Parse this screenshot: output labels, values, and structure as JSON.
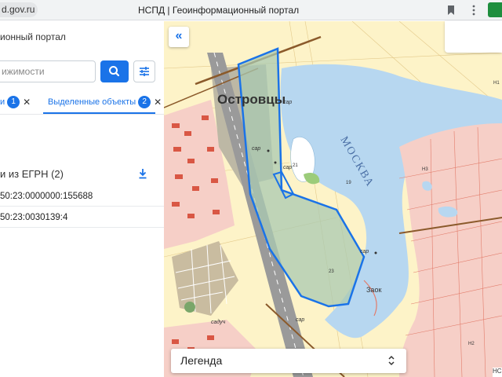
{
  "browser": {
    "url_fragment": "d.gov.ru",
    "tab_title": "НСПД | Геоинформационный портал"
  },
  "panel": {
    "portal_label": "ионный портал",
    "search_placeholder": "ижимости",
    "tabs": [
      {
        "label": "и",
        "count": "1"
      },
      {
        "label": "Выделенные объекты",
        "count": "2"
      }
    ],
    "egrn_title": "и из ЕГРН (2)",
    "rows": [
      "50:23:0000000:155688",
      "50:23:0030139:4"
    ]
  },
  "map": {
    "labels": {
      "town": "Островцы",
      "river": "МОСКВА",
      "sar1": "сар",
      "sar2": "сар",
      "sar3": "сар",
      "sar4": "сар",
      "sar5": "сар",
      "sadch": "садуч",
      "zaok": "Заок",
      "num21": "21",
      "num19": "19",
      "num23": "23",
      "n3": "Н3",
      "n2": "Н2",
      "n1": "Н1",
      "ns": "НС"
    },
    "legend": "Легенда",
    "colors": {
      "selection": "#1a73e8",
      "water": "#b7d7f0",
      "residential": "#f3b3a8",
      "forest": "#c8dcc1",
      "base": "#fdf3c8"
    }
  }
}
